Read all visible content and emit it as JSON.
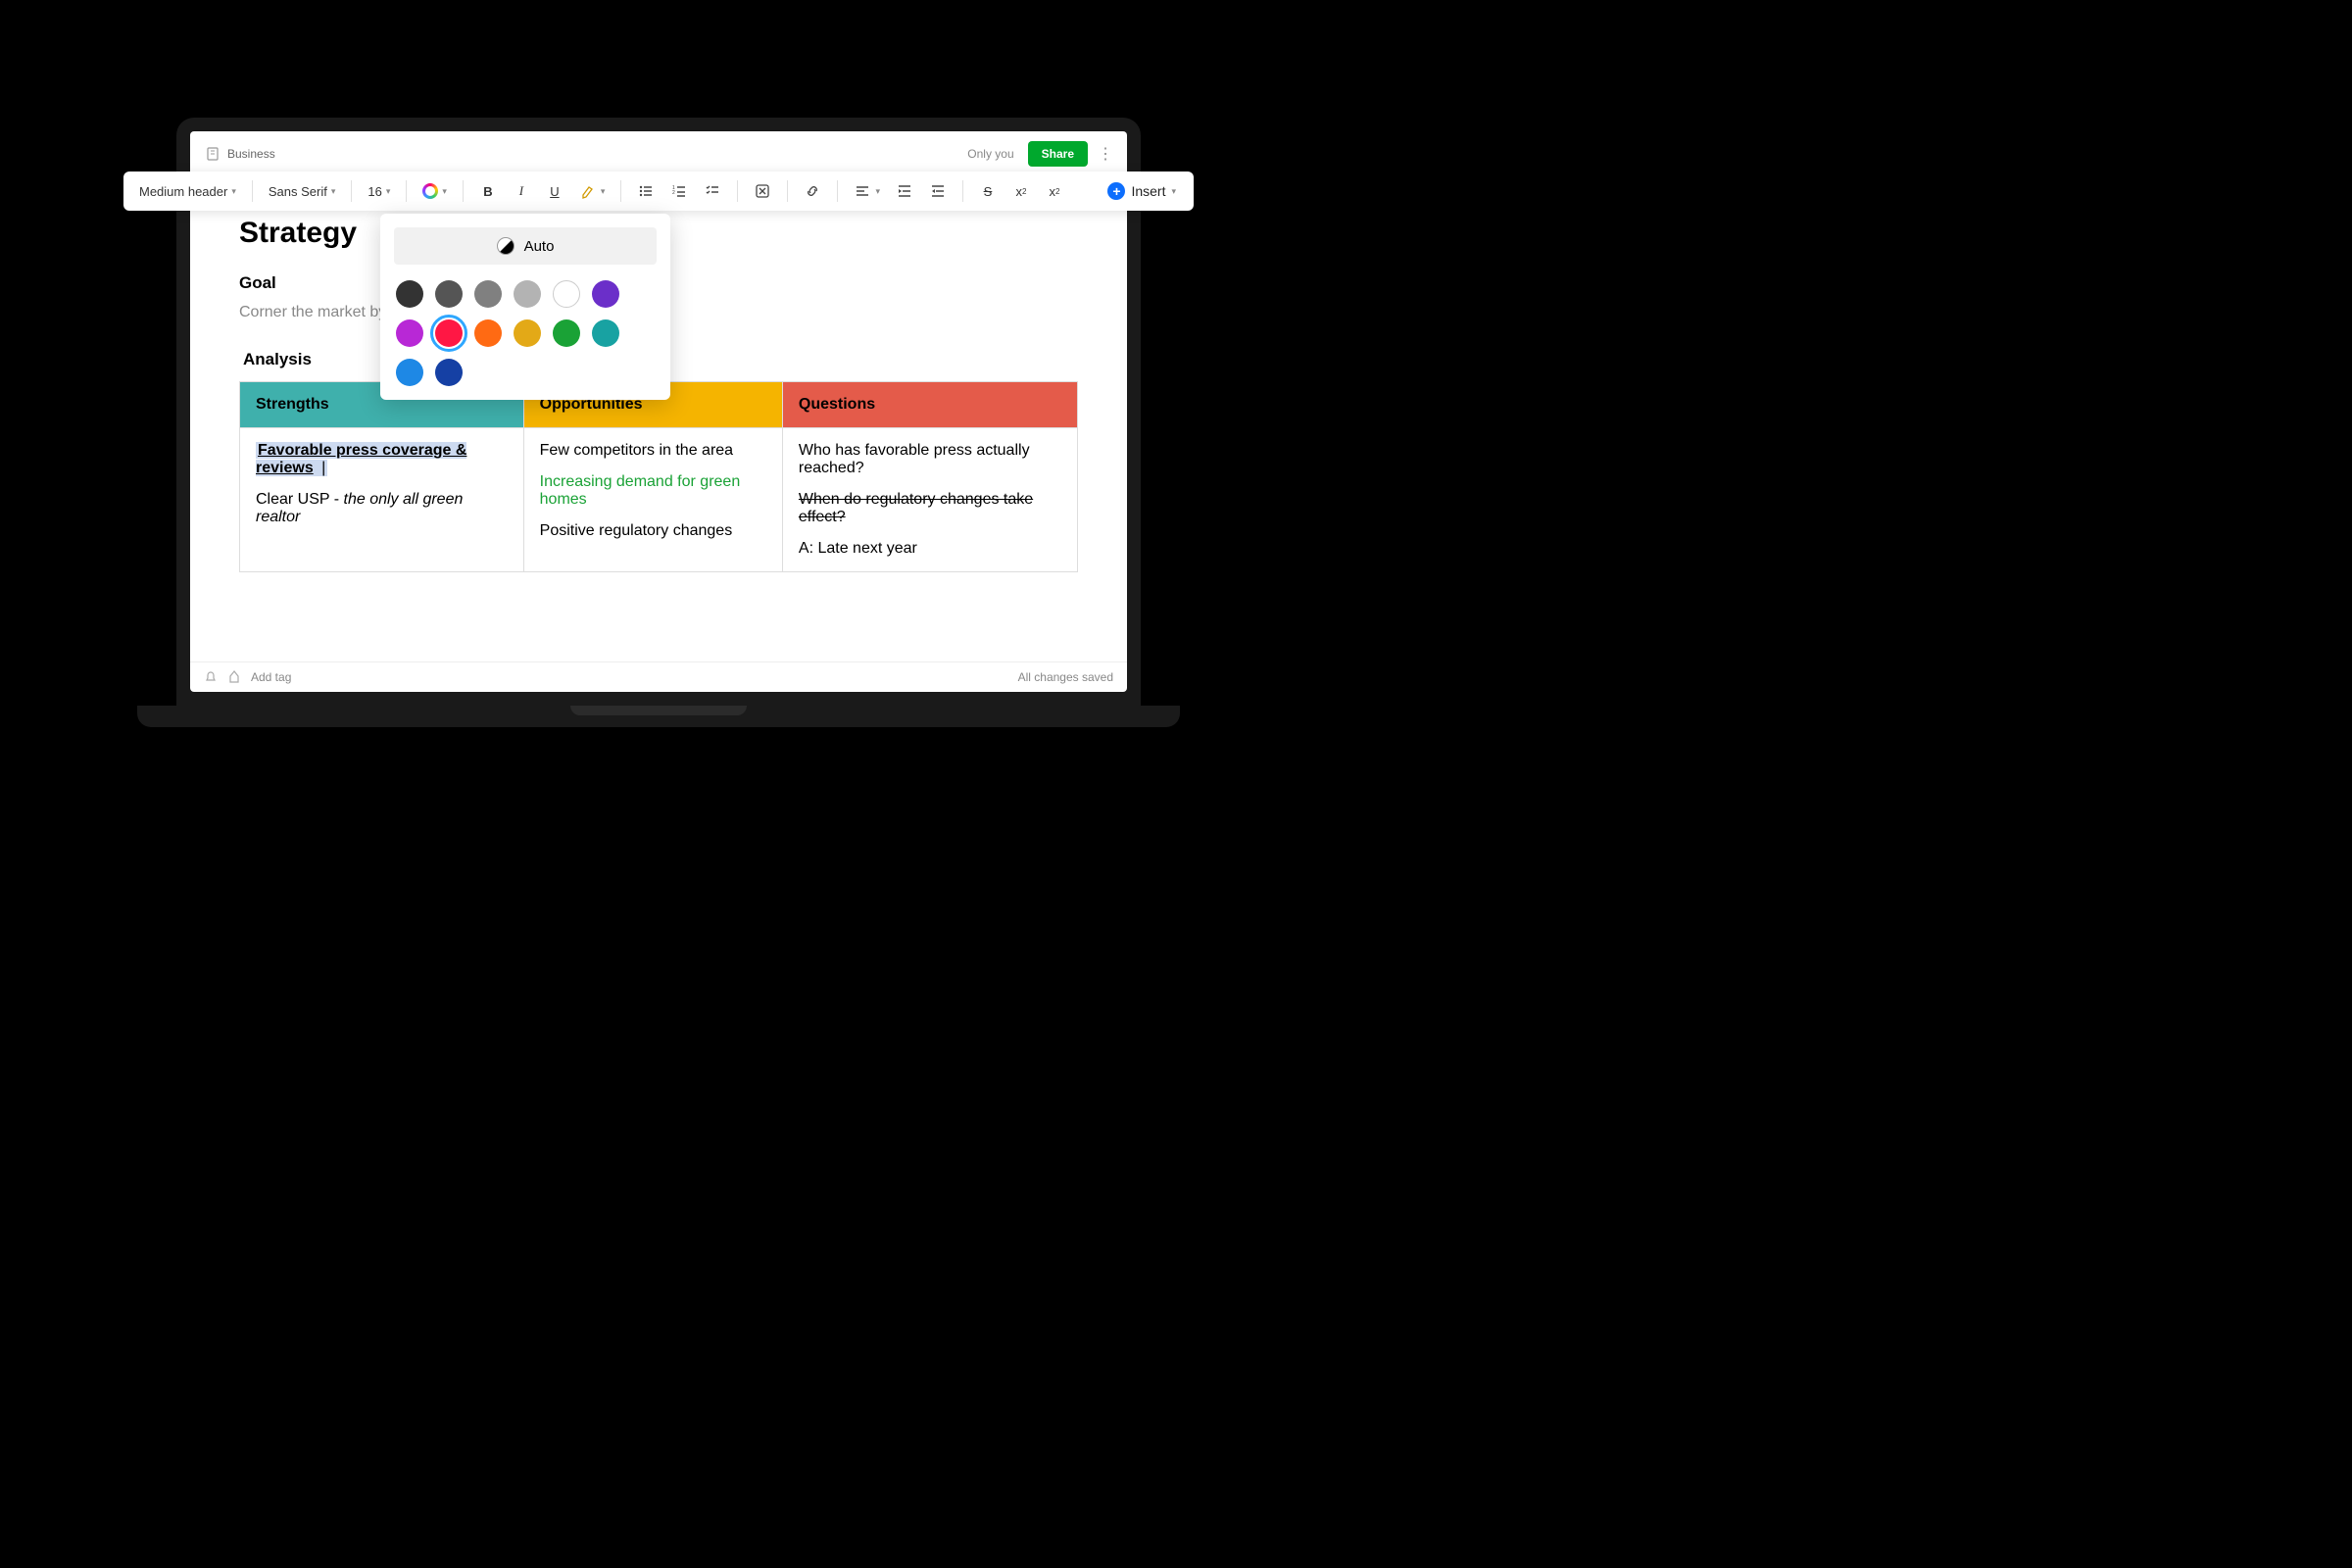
{
  "top": {
    "breadcrumb": "Business",
    "only_you": "Only you",
    "share": "Share"
  },
  "toolbar": {
    "heading": "Medium header",
    "font": "Sans Serif",
    "size": "16",
    "insert": "Insert"
  },
  "color_picker": {
    "auto": "Auto",
    "row1": [
      "#333333",
      "#555555",
      "#808080",
      "#b3b3b3",
      "#ffffff",
      "#6b2fc9",
      "#b828d6"
    ],
    "row2": [
      "#ff1744",
      "#ff6a13",
      "#e3a917",
      "#1aa236",
      "#18a2a2",
      "#1e88e5",
      "#1540a4"
    ],
    "selected_index": 7
  },
  "doc": {
    "title": "Strategy",
    "goal_h": "Goal",
    "goal_text": "Corner the market by specializing in modern, net-zero p",
    "analysis_h": "Analysis",
    "table": {
      "headers": {
        "strengths": "Strengths",
        "opportunities": "Opportunities",
        "questions": "Questions"
      },
      "strengths": {
        "p1": "Favorable press coverage & reviews",
        "cursor": " |",
        "p2a": "Clear USP - ",
        "p2b": "the only all green realtor"
      },
      "opportunities": {
        "p1": "Few competitors in the area",
        "p2": "Increasing demand for green homes",
        "p3": "Positive regulatory changes"
      },
      "questions": {
        "p1": "Who has favorable press actually reached?",
        "p2": "When do regulatory changes take effect?",
        "p3": "A: Late next year"
      }
    }
  },
  "bottom": {
    "add_tag": "Add tag",
    "saved": "All changes saved"
  }
}
